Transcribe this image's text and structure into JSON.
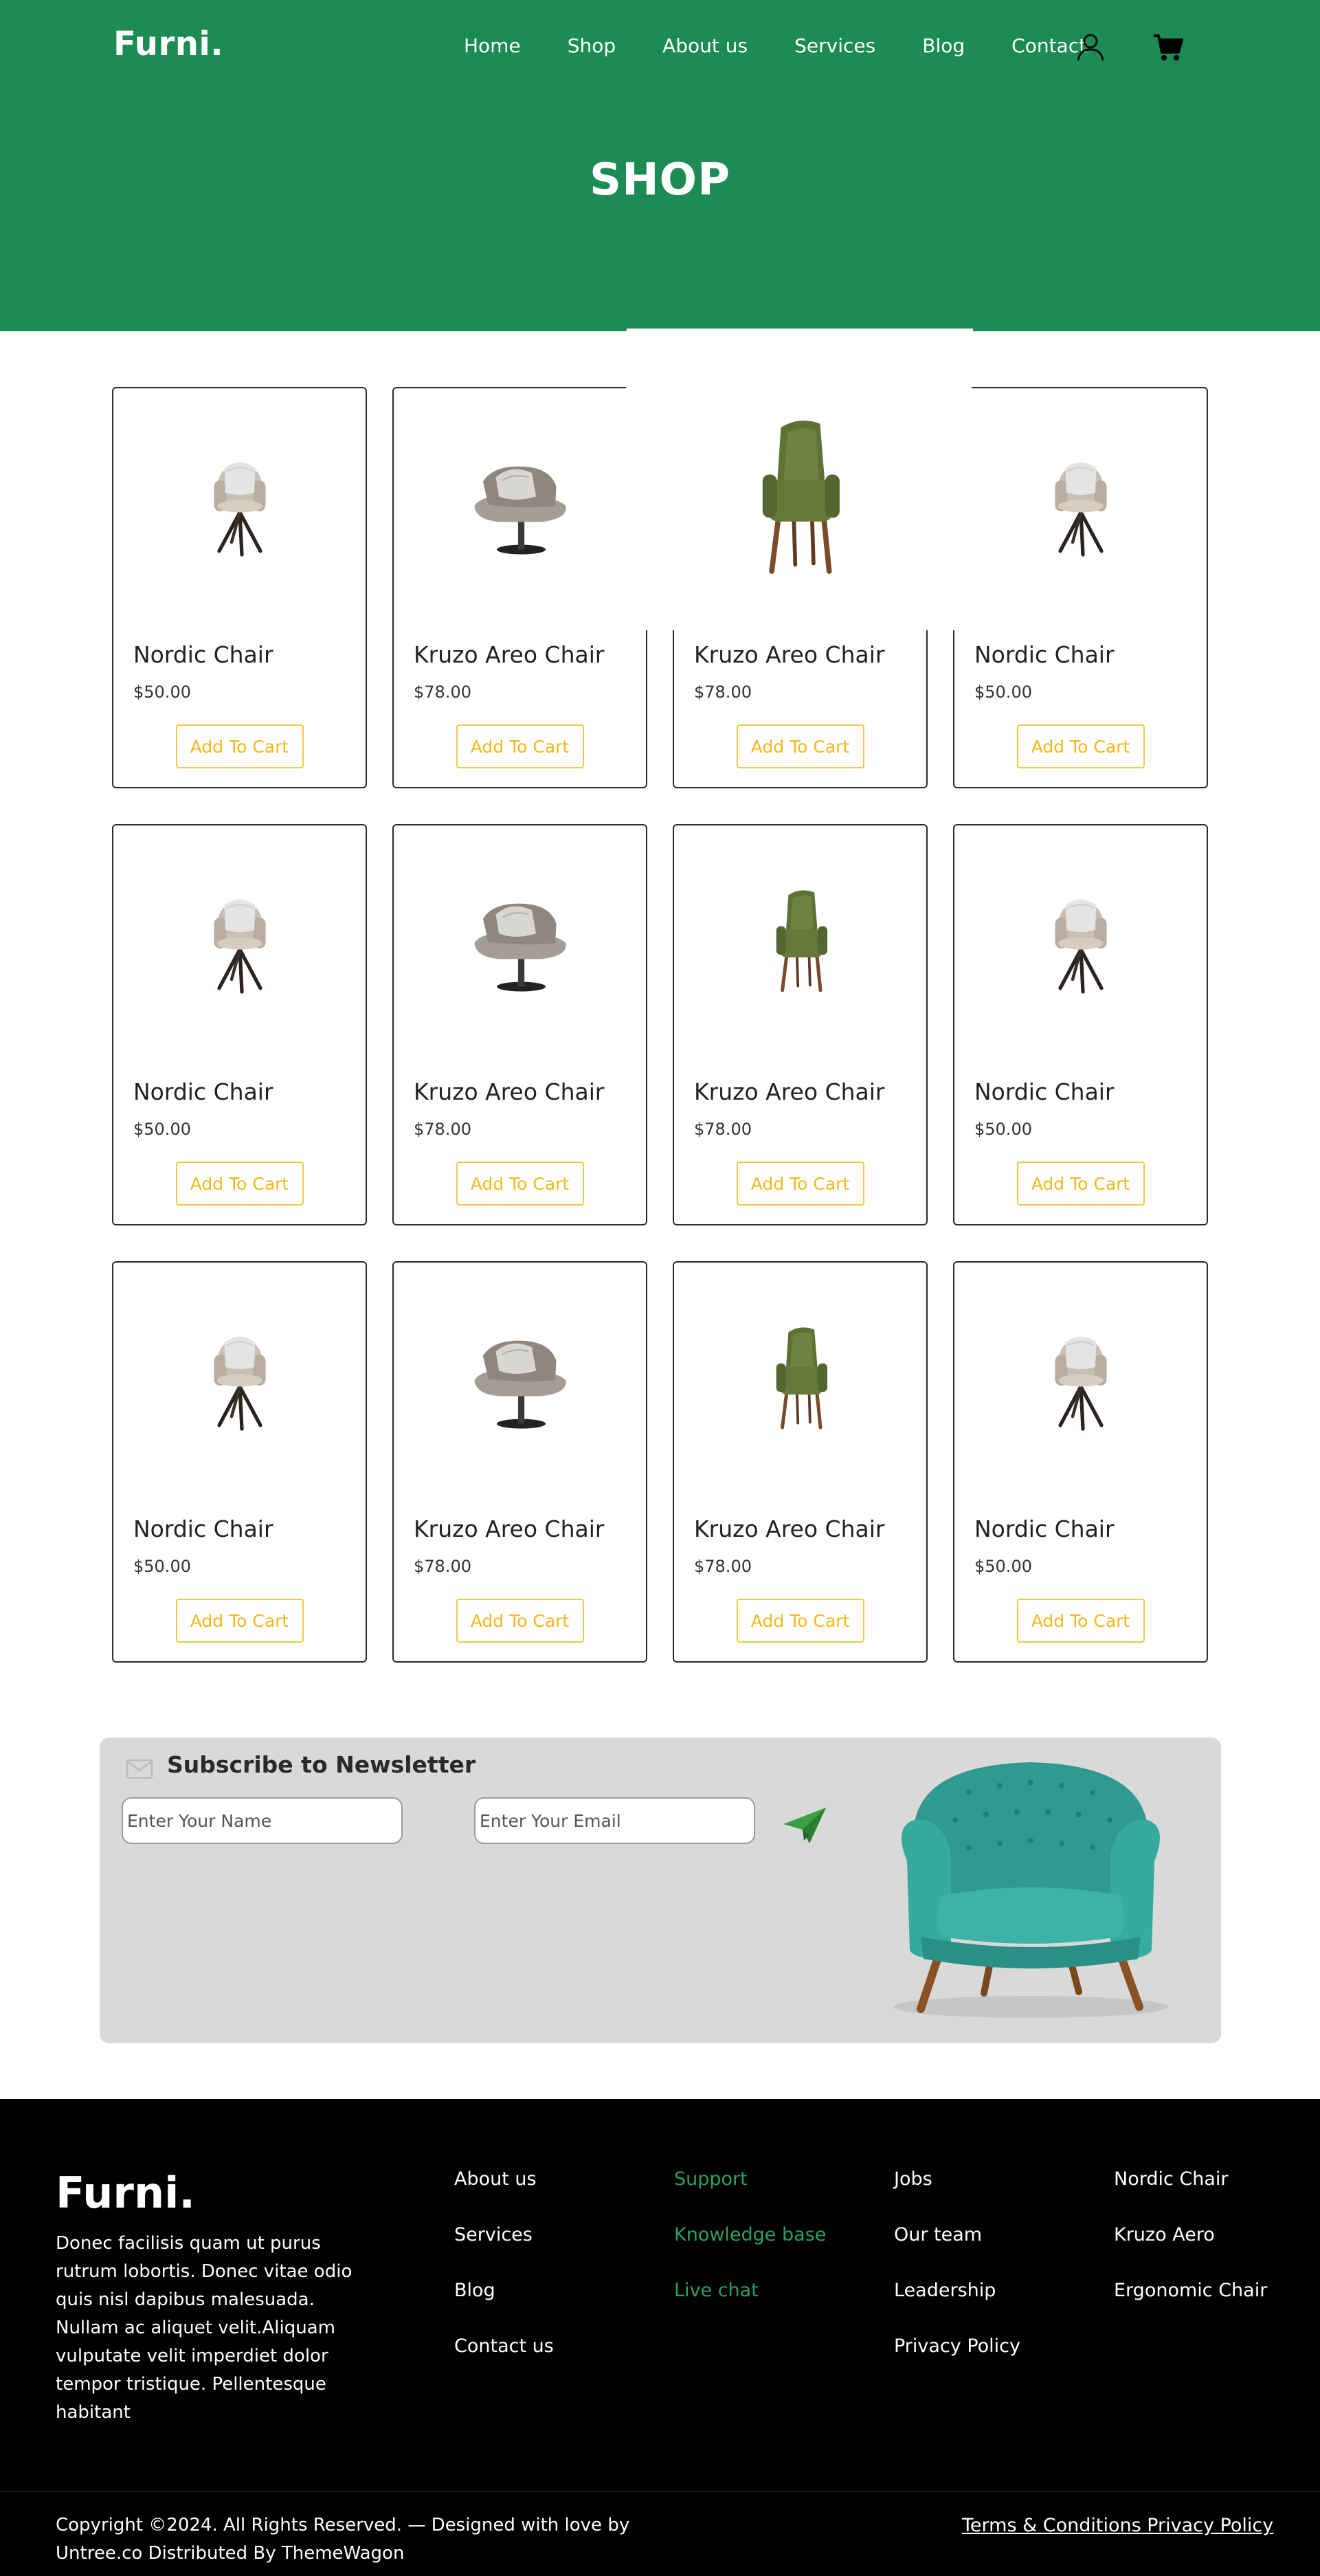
{
  "brand": {
    "logo": "Furni."
  },
  "nav": {
    "items": [
      "Home",
      "Shop",
      "About us",
      "Services",
      "Blog",
      "Contact"
    ],
    "user_icon": "user-icon",
    "cart_icon": "cart-icon"
  },
  "page": {
    "title": "SHOP"
  },
  "colors": {
    "primary": "#1c8b54",
    "accent": "#f3c847",
    "newsletter_bg": "#d9d9d9",
    "footer_bg": "#000000",
    "footer_link_green": "#2f9e5f"
  },
  "products": [
    {
      "name": "Nordic Chair",
      "price": "$50.00",
      "button": "Add To Cart",
      "image": "nordic-chair"
    },
    {
      "name": "Kruzo Areo Chair",
      "price": "$78.00",
      "button": "Add To Cart",
      "image": "kruzo-swivel-chair"
    },
    {
      "name": "Kruzo Areo Chair",
      "price": "$78.00",
      "button": "Add To Cart",
      "image": "green-dining-chair"
    },
    {
      "name": "Nordic Chair",
      "price": "$50.00",
      "button": "Add To Cart",
      "image": "nordic-chair"
    },
    {
      "name": "Nordic Chair",
      "price": "$50.00",
      "button": "Add To Cart",
      "image": "nordic-chair"
    },
    {
      "name": "Kruzo Areo Chair",
      "price": "$78.00",
      "button": "Add To Cart",
      "image": "kruzo-swivel-chair"
    },
    {
      "name": "Kruzo Areo Chair",
      "price": "$78.00",
      "button": "Add To Cart",
      "image": "green-dining-chair"
    },
    {
      "name": "Nordic Chair",
      "price": "$50.00",
      "button": "Add To Cart",
      "image": "nordic-chair"
    },
    {
      "name": "Nordic Chair",
      "price": "$50.00",
      "button": "Add To Cart",
      "image": "nordic-chair"
    },
    {
      "name": "Kruzo Areo Chair",
      "price": "$78.00",
      "button": "Add To Cart",
      "image": "kruzo-swivel-chair"
    },
    {
      "name": "Kruzo Areo Chair",
      "price": "$78.00",
      "button": "Add To Cart",
      "image": "green-dining-chair"
    },
    {
      "name": "Nordic Chair",
      "price": "$50.00",
      "button": "Add To Cart",
      "image": "nordic-chair"
    }
  ],
  "newsletter": {
    "title": "Subscribe to Newsletter",
    "name_placeholder": "Enter Your Name",
    "email_placeholder": "Enter Your Email",
    "icon": "mail-icon",
    "send_icon": "paper-plane-icon"
  },
  "footer": {
    "logo": "Furni.",
    "description": "Donec facilisis quam ut purus rutrum lobortis. Donec vitae odio quis nisl dapibus malesuada. Nullam ac aliquet velit.Aliquam vulputate velit imperdiet dolor tempor tristique. Pellentesque habitant",
    "col1": [
      "About us",
      "Services",
      "Blog",
      "Contact us"
    ],
    "col2": [
      "Support",
      "Knowledge base",
      "Live chat"
    ],
    "col3": [
      "Jobs",
      "Our team",
      "Leadership",
      "Privacy Policy"
    ],
    "col4": [
      "Nordic Chair",
      "Kruzo Aero",
      "Ergonomic Chair"
    ],
    "copyright": "Copyright ©2024. All Rights Reserved. — Designed with love by Untree.co Distributed By ThemeWagon",
    "legal": "Terms & Conditions Privacy Policy"
  }
}
